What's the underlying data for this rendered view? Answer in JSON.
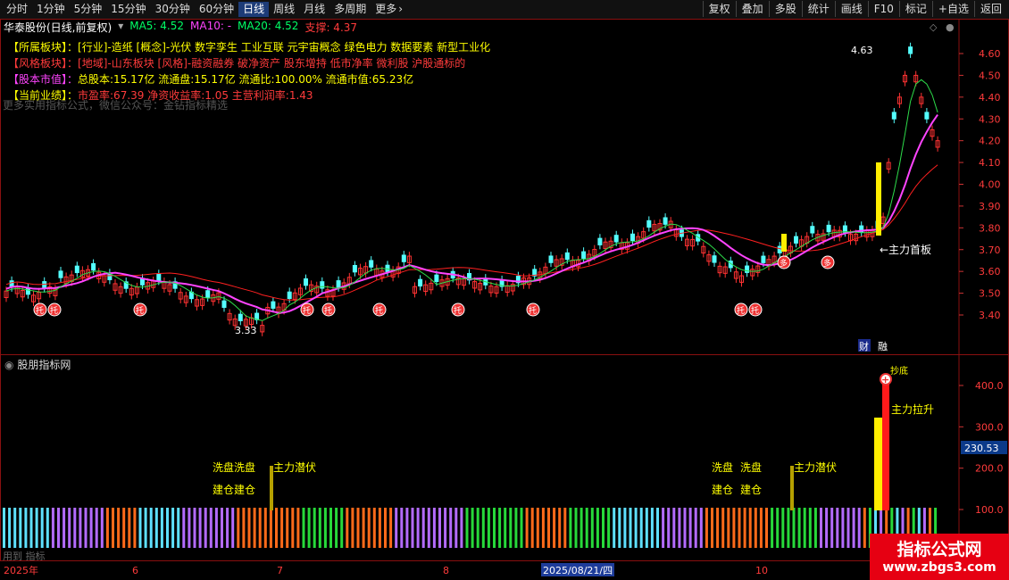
{
  "toolbar": {
    "tabs": [
      "分时",
      "1分钟",
      "5分钟",
      "15分钟",
      "30分钟",
      "60分钟",
      "日线",
      "周线",
      "月线",
      "多周期",
      "更多"
    ],
    "active_tab": "日线",
    "right_buttons": [
      "复权",
      "叠加",
      "多股",
      "统计",
      "画线",
      "F10",
      "标记",
      "+自选",
      "返回"
    ]
  },
  "header": {
    "stock": "华泰股份(日线,前复权)",
    "ma5": "MA5: 4.52",
    "ma10": "MA10: -",
    "ma20": "MA20: 4.52",
    "support": "支撑: 4.37"
  },
  "info": [
    {
      "label": "【所属板块】：",
      "value": "[行业]-造纸 [概念]-光伏 数字孪生 工业互联 元宇宙概念 绿色电力 数据要素 新型工业化",
      "lc": "#ffff00",
      "vc": "#ffff00"
    },
    {
      "label": "【风格板块】：",
      "value": "[地域]-山东板块 [风格]-融资融券 破净资产 股东增持 低市净率 微利股 沪股通标的",
      "lc": "#ff3b3b",
      "vc": "#ff3b3b"
    },
    {
      "label": "【股本市值】：",
      "value": "总股本:15.17亿 流通盘:15.17亿 流通比:100.00% 流通市值:65.23亿",
      "lc": "#ff44ff",
      "vc": "#ffff00"
    },
    {
      "label": "【当前业绩】：",
      "value": "市盈率:67.39 净资收益率:1.05 主营利润率:1.43",
      "lc": "#ffff00",
      "vc": "#ff3b3b"
    }
  ],
  "watermark": "更多实用指标公式，微信公众号：金钻指标精选",
  "main_chart": {
    "price_ticks": [
      "4.60",
      "4.50",
      "4.40",
      "4.30",
      "4.20",
      "4.10",
      "4.00",
      "3.90",
      "3.80",
      "3.70",
      "3.60",
      "3.50",
      "3.40"
    ],
    "high_label": "4.63",
    "low_label": "3.33",
    "annotation_main": "←主力首板",
    "tag_cai": "财",
    "tag_xiju": "融",
    "tuo_glyph": "托",
    "duo_glyph": "多"
  },
  "sub_panel": {
    "title": "股朋指标网",
    "ticks": [
      "400.0",
      "300.0",
      "200.0",
      "100.0"
    ],
    "value_badge": "230.53",
    "label_xipan1": "洗盘洗盘",
    "label_jiancang1": "建仓建仓",
    "label_zhuli1": "主力潜伏",
    "label_xipan2a": "洗盘",
    "label_xipan2b": "洗盘",
    "label_jiancang2a": "建仓",
    "label_jiancang2b": "建仓",
    "label_zhuli2": "主力潜伏",
    "label_lasheng": "主力拉升",
    "label_top": "抄底"
  },
  "xaxis": {
    "labels": [
      "2025年",
      "6",
      "7",
      "8",
      "2025/08/21/四",
      "10"
    ]
  },
  "footer_left": "用到 指标",
  "logo": {
    "line1": "指标公式网",
    "line2": "www.zbgs3.com"
  },
  "chart_data": {
    "type": "candlestick",
    "ylim": [
      3.3,
      4.7
    ],
    "colors": {
      "up": "#ff3232",
      "down": "#54ffff",
      "ma5": "#ffffff",
      "ma10": "#ff44ff",
      "ma20": "#ff2020"
    }
  }
}
